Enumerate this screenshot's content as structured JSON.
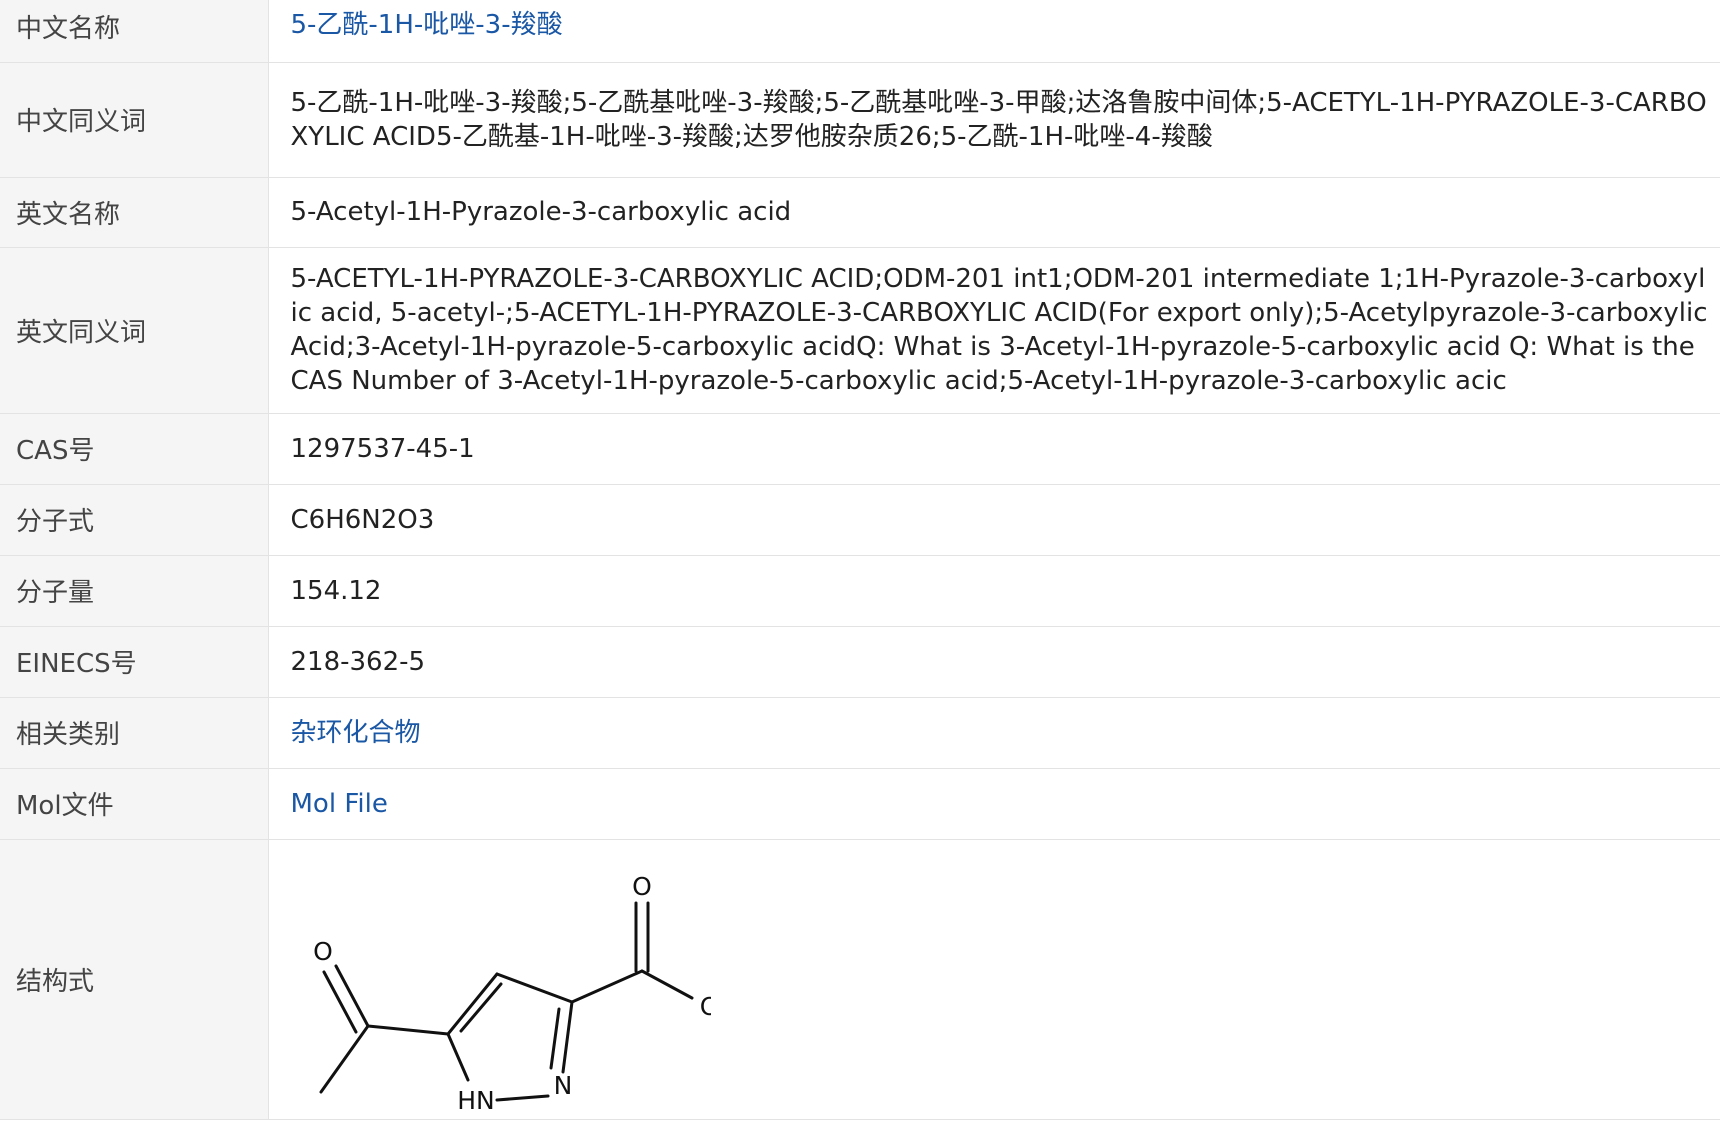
{
  "rows": {
    "chinese_name": {
      "label": "中文名称",
      "value": "5-乙酰-1H-吡唑-3-羧酸"
    },
    "chinese_synonyms": {
      "label": "中文同义词",
      "value": "5-乙酰-1H-吡唑-3-羧酸;5-乙酰基吡唑-3-羧酸;5-乙酰基吡唑-3-甲酸;达洛鲁胺中间体;5-ACETYL-1H-PYRAZOLE-3-CARBOXYLIC ACID5-乙酰基-1H-吡唑-3-羧酸;达罗他胺杂质26;5-乙酰-1H-吡唑-4-羧酸"
    },
    "english_name": {
      "label": "英文名称",
      "value": "5-Acetyl-1H-Pyrazole-3-carboxylic acid"
    },
    "english_synonyms": {
      "label": "英文同义词",
      "value": "5-ACETYL-1H-PYRAZOLE-3-CARBOXYLIC ACID;ODM-201 int1;ODM-201 intermediate 1;1H-Pyrazole-3-carboxylic acid, 5-acetyl-;5-ACETYL-1H-PYRAZOLE-3-CARBOXYLIC ACID(For export only);5-Acetylpyrazole-3-carboxylic Acid;3-Acetyl-1H-pyrazole-5-carboxylic acidQ: What is 3-Acetyl-1H-pyrazole-5-carboxylic acid Q: What is the CAS Number of 3-Acetyl-1H-pyrazole-5-carboxylic acid;5-Acetyl-1H-pyrazole-3-carboxylic acic"
    },
    "cas": {
      "label": "CAS号",
      "value": "1297537-45-1"
    },
    "formula": {
      "label": "分子式",
      "value": "C6H6N2O3"
    },
    "mol_weight": {
      "label": "分子量",
      "value": "154.12"
    },
    "einecs": {
      "label": "EINECS号",
      "value": "218-362-5"
    },
    "category": {
      "label": "相关类别",
      "value": "杂环化合物"
    },
    "mol_file": {
      "label": "Mol文件",
      "value": "Mol File"
    },
    "structure": {
      "label": "结构式",
      "atoms": {
        "o_acetyl": "O",
        "o_carbonyl": "O",
        "oh": "OH",
        "nh": "HN",
        "n": "N"
      }
    }
  },
  "colors": {
    "link": "#1a57a5",
    "label_bg": "#f5f5f5",
    "border": "#e3e3e3"
  }
}
